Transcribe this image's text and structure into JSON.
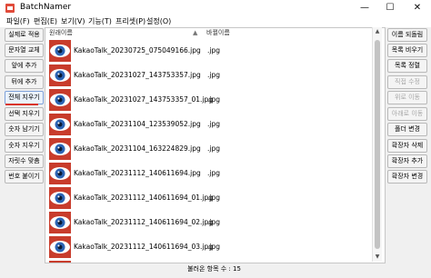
{
  "window": {
    "title": "BatchNamer",
    "minimize": "—",
    "maximize": "☐",
    "close": "✕"
  },
  "menu": [
    "파일(F)",
    "편집(E)",
    "보기(V)",
    "기능(T)",
    "프리셋(P)",
    "설정(O)"
  ],
  "left_buttons": [
    {
      "label": "실제로 적용",
      "disabled": false
    },
    {
      "label": "문자열 교체",
      "disabled": false
    },
    {
      "label": "앞에 추가",
      "disabled": false
    },
    {
      "label": "뒤에 추가",
      "disabled": false
    },
    {
      "label": "전체 지우기",
      "disabled": false
    },
    {
      "label": "선택 지우기",
      "disabled": false
    },
    {
      "label": "숫자 남기기",
      "disabled": false
    },
    {
      "label": "숫자 지우기",
      "disabled": false
    },
    {
      "label": "자릿수 맞춤",
      "disabled": false
    },
    {
      "label": "번호 붙이기",
      "disabled": false
    }
  ],
  "right_buttons": [
    {
      "label": "이름 되돌림",
      "disabled": false
    },
    {
      "label": "목록 비우기",
      "disabled": false
    },
    {
      "label": "목록 정렬",
      "disabled": false
    },
    {
      "label": "직접 수정",
      "disabled": true
    },
    {
      "label": "위로 이동",
      "disabled": true
    },
    {
      "label": "아래로 이동",
      "disabled": true
    },
    {
      "label": "폴더 변경",
      "disabled": false
    },
    {
      "label": "확장자 삭제",
      "disabled": false
    },
    {
      "label": "확장자 추가",
      "disabled": false
    },
    {
      "label": "확장자 변경",
      "disabled": false
    }
  ],
  "columns": {
    "name": "원래이름",
    "new_name": "바뀔이름"
  },
  "files": [
    {
      "name": "KakaoTalk_20230725_075049166.jpg",
      "ext": ".jpg"
    },
    {
      "name": "KakaoTalk_20231027_143753357.jpg",
      "ext": ".jpg"
    },
    {
      "name": "KakaoTalk_20231027_143753357_01.jpg",
      "ext": ".jpg"
    },
    {
      "name": "KakaoTalk_20231104_123539052.jpg",
      "ext": ".jpg"
    },
    {
      "name": "KakaoTalk_20231104_163224829.jpg",
      "ext": ".jpg"
    },
    {
      "name": "KakaoTalk_20231112_140611694.jpg",
      "ext": ".jpg"
    },
    {
      "name": "KakaoTalk_20231112_140611694_01.jpg",
      "ext": ".jpg"
    },
    {
      "name": "KakaoTalk_20231112_140611694_02.jpg",
      "ext": ".jpg"
    },
    {
      "name": "KakaoTalk_20231112_140611694_03.jpg",
      "ext": ".jpg"
    },
    {
      "name": "",
      "ext": ""
    }
  ],
  "status": "불러온 항목 수 : 15",
  "colors": {
    "accent_underline": "#d9342b",
    "thumb_red": "#c83c2c",
    "eye_blue": "#2c64b4"
  },
  "icons": {
    "file_thumb": "eye-icon",
    "app": "batchnamer-app-icon"
  }
}
